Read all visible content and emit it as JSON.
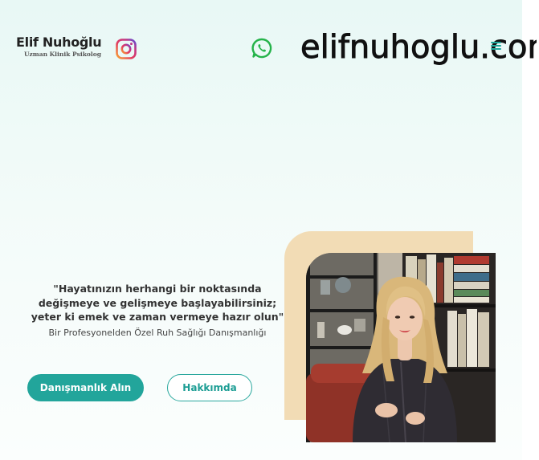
{
  "brand": {
    "name": "Elif Nuhoğlu",
    "subtitle": "Uzman Klinik Psikolog"
  },
  "header": {
    "social_icons": [
      "instagram-icon",
      "whatsapp-icon"
    ],
    "menu_icon": "hamburger-menu-icon"
  },
  "watermark": {
    "text": "elifnuhoglu.com"
  },
  "hero": {
    "quote_lines": [
      "\"Hayatınızın herhangi bir noktasında",
      "değişmeye ve gelişmeye başlayabilirsiniz;",
      "yeter ki emek ve zaman vermeye hazır olun\""
    ],
    "subtitle": "Bir Profesyonelden Özel Ruh Sağlığı Danışmanlığı",
    "primary_button": "Danışmanlık Alın",
    "secondary_button": "Hakkımda"
  },
  "colors": {
    "accent": "#22a59b",
    "whatsapp": "#25b34a",
    "card": "#f2dcb5",
    "background": "#e8f8f5"
  }
}
